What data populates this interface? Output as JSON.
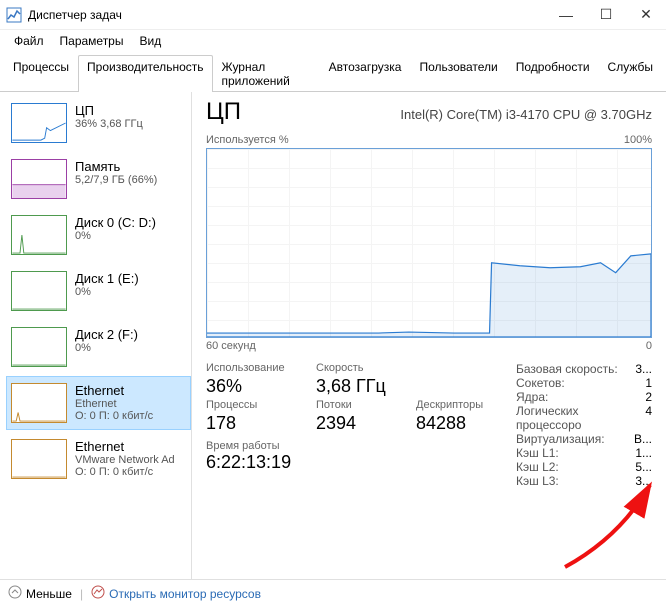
{
  "window": {
    "title": "Диспетчер задач"
  },
  "menu": {
    "file": "Файл",
    "options": "Параметры",
    "view": "Вид"
  },
  "tabs": {
    "processes": "Процессы",
    "performance": "Производительность",
    "apphist": "Журнал приложений",
    "startup": "Автозагрузка",
    "users": "Пользователи",
    "details": "Подробности",
    "services": "Службы",
    "active": "performance"
  },
  "sidebar": [
    {
      "id": "cpu",
      "title": "ЦП",
      "line2": "36% 3,68 ГГц",
      "color": "#2a7bd1"
    },
    {
      "id": "memory",
      "title": "Память",
      "line2": "5,2/7,9 ГБ (66%)",
      "color": "#9b3fa5"
    },
    {
      "id": "disk0",
      "title": "Диск 0 (C: D:)",
      "line2": "0%",
      "color": "#4e9a4e"
    },
    {
      "id": "disk1",
      "title": "Диск 1 (E:)",
      "line2": "0%",
      "color": "#4e9a4e"
    },
    {
      "id": "disk2",
      "title": "Диск 2 (F:)",
      "line2": "0%",
      "color": "#4e9a4e"
    },
    {
      "id": "eth0",
      "title": "Ethernet",
      "line2": "Ethernet",
      "line3": "О: 0 П: 0 кбит/с",
      "color": "#c48a2f",
      "selected": true
    },
    {
      "id": "eth1",
      "title": "Ethernet",
      "line2": "VMware Network Ad",
      "line3": "О: 0 П: 0 кбит/с",
      "color": "#c48a2f"
    }
  ],
  "main": {
    "title": "ЦП",
    "model": "Intel(R) Core(TM) i3-4170 CPU @ 3.70GHz",
    "chart_top_left": "Используется %",
    "chart_top_right": "100%",
    "chart_bottom_left": "60 секунд",
    "chart_bottom_right": "0",
    "stats_left": {
      "use_label": "Использование",
      "use_value": "36%",
      "speed_label": "Скорость",
      "speed_value": "3,68 ГГц",
      "proc_label": "Процессы",
      "proc_value": "178",
      "threads_label": "Потоки",
      "threads_value": "2394",
      "handles_label": "Дескрипторы",
      "handles_value": "84288"
    },
    "stats_right": [
      {
        "label": "Базовая скорость:",
        "value": "3..."
      },
      {
        "label": "Сокетов:",
        "value": "1"
      },
      {
        "label": "Ядра:",
        "value": "2"
      },
      {
        "label": "Логических процессоро",
        "value": "4"
      },
      {
        "label": "Виртуализация:",
        "value": "В..."
      },
      {
        "label": "Кэш L1:",
        "value": "1..."
      },
      {
        "label": "Кэш L2:",
        "value": "5..."
      },
      {
        "label": "Кэш L3:",
        "value": "3..."
      }
    ],
    "uptime": {
      "label": "Время работы",
      "value": "6:22:13:19"
    }
  },
  "footer": {
    "fewer": "Меньше",
    "monitor": "Открыть монитор ресурсов"
  },
  "chart_data": {
    "type": "line",
    "title": "Используется %",
    "xlabel": "60 секунд",
    "ylabel": "",
    "ylim": [
      0,
      100
    ],
    "xlim": [
      60,
      0
    ],
    "x": [
      60,
      55,
      50,
      45,
      40,
      35,
      30,
      25,
      20,
      15,
      10,
      5,
      0
    ],
    "values": [
      2,
      2,
      2,
      2,
      2,
      3,
      2,
      2,
      40,
      38,
      37,
      42,
      44
    ]
  }
}
